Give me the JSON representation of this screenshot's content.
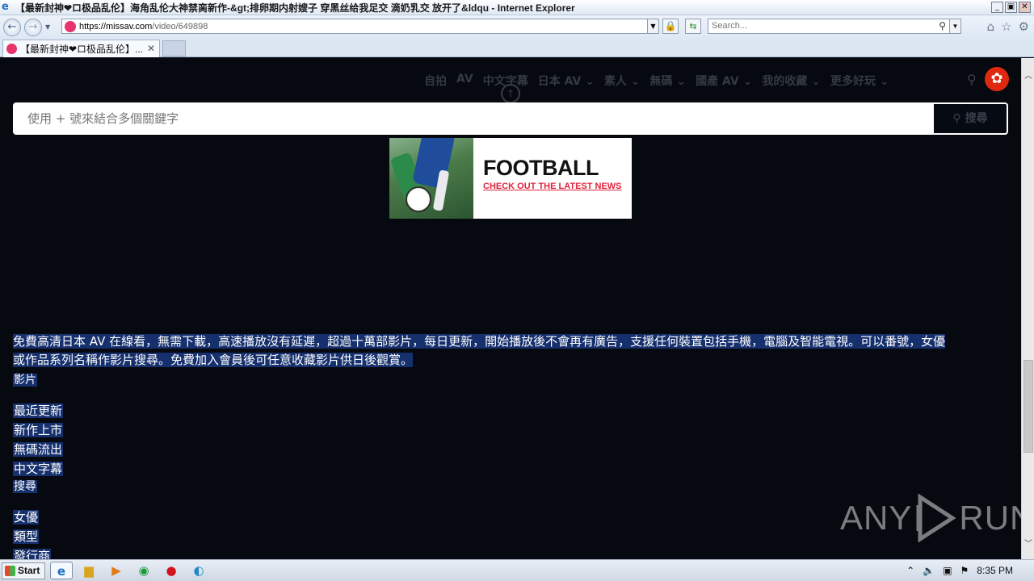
{
  "window": {
    "title": "【最新封神❤︎ロ极品乱伦】海角乱伦大神禁脔新作-&gt;排卵期内射嫂子 穿黑丝给我足交 滴奶乳交 放开了&ldqu - Internet Explorer",
    "minimize": "_",
    "maximize": "▣",
    "close": "✕"
  },
  "browser": {
    "back": "←",
    "forward": "→",
    "url_host": "https://missav.com",
    "url_path": "/video/649898",
    "search_placeholder": "Search...",
    "tab_title": "【最新封神❤︎ロ极品乱伦】...",
    "tab_close": "✕"
  },
  "site": {
    "nav_items": [
      "自拍",
      "AV",
      "中文字幕",
      "日本 AV ⌄",
      "素人 ⌄",
      "無碼 ⌄",
      "國產 AV ⌄",
      "我的收藏 ⌄",
      "更多好玩 ⌄"
    ],
    "search_placeholder": "使用 + 號來結合多個關鍵字",
    "search_button": "搜尋",
    "ad": {
      "headline": "FOOTBALL",
      "subline": "CHECK OUT THE LATEST NEWS"
    },
    "description_line1": "免費高清日本 AV 在線看，無需下載，高速播放沒有延遲，超過十萬部影片，每日更新，開始播放後不會再有廣告，支援任何裝置包括手機，電腦及智能電視。可以番號，女優",
    "description_line2": "或作品系列名稱作影片搜尋。免費加入會員後可任意收藏影片供日後觀賞。",
    "section_videos": "影片",
    "video_links": [
      "最近更新",
      "新作上市",
      "無碼流出",
      "中文字幕"
    ],
    "section_search": "搜尋",
    "search_links": [
      "女優",
      "類型",
      "發行商"
    ]
  },
  "watermark": {
    "left": "ANY",
    "right": "RUN"
  },
  "taskbar": {
    "start_label": "Start",
    "clock": "8:35 PM"
  },
  "colors": {
    "page_bg": "#06090f",
    "selection": "#16306d",
    "accent_red": "#e0223c"
  }
}
